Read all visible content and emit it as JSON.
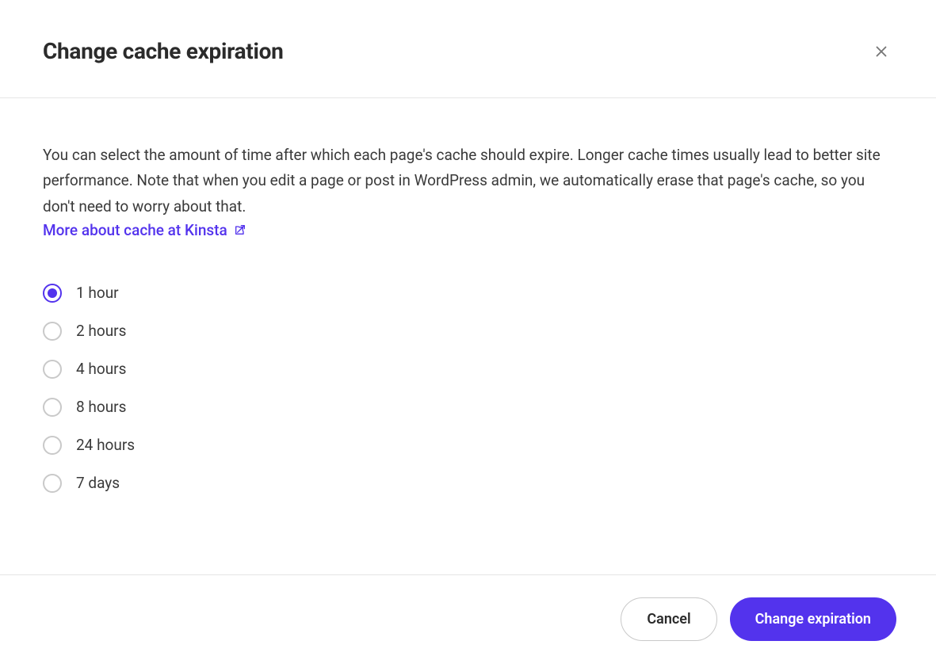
{
  "header": {
    "title": "Change cache expiration"
  },
  "body": {
    "description": "You can select the amount of time after which each page's cache should expire. Longer cache times usually lead to better site performance. Note that when you edit a page or post in WordPress admin, we automatically erase that page's cache, so you don't need to worry about that.",
    "link_text": "More about cache at Kinsta"
  },
  "options": [
    {
      "label": "1 hour",
      "checked": true
    },
    {
      "label": "2 hours",
      "checked": false
    },
    {
      "label": "4 hours",
      "checked": false
    },
    {
      "label": "8 hours",
      "checked": false
    },
    {
      "label": "24 hours",
      "checked": false
    },
    {
      "label": "7 days",
      "checked": false
    }
  ],
  "footer": {
    "cancel_label": "Cancel",
    "submit_label": "Change expiration"
  },
  "colors": {
    "accent": "#5333ed"
  }
}
